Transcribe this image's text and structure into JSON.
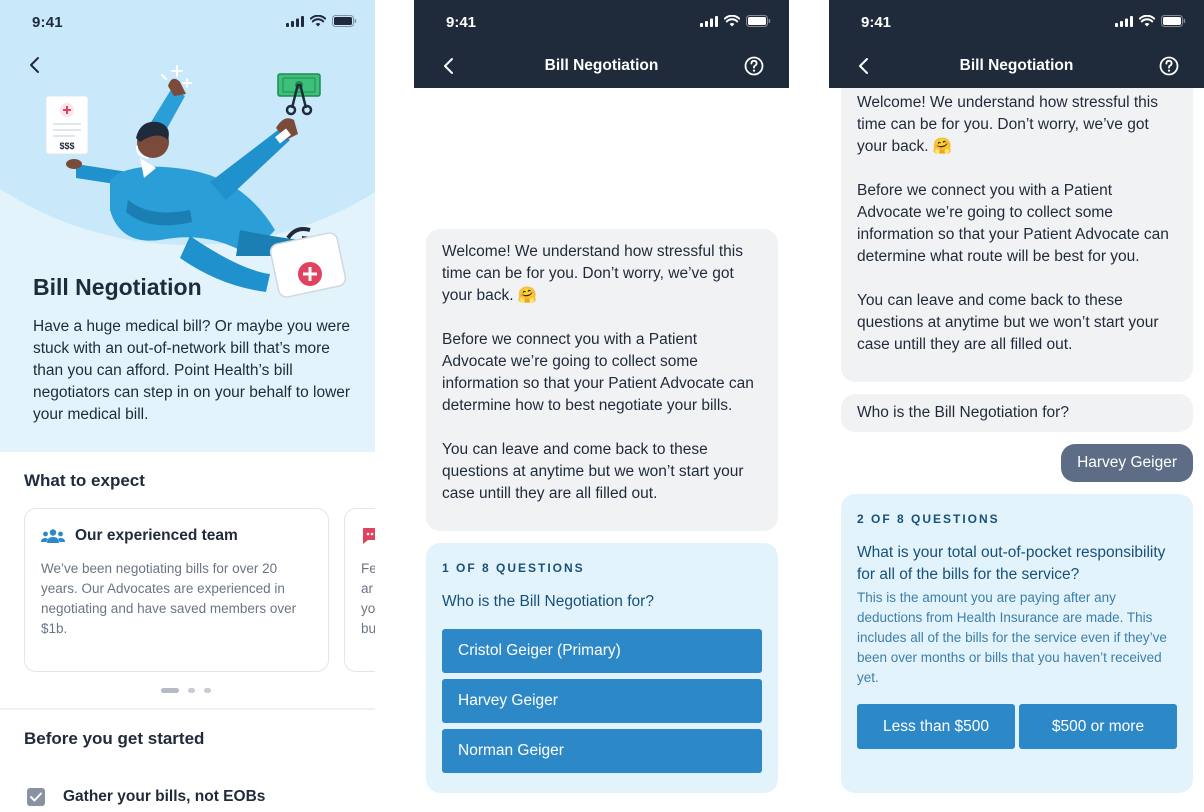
{
  "status_time": "9:41",
  "screen1": {
    "illustration_bill_text": "$$$",
    "title": "Bill Negotiation",
    "body": "Have a huge medical bill? Or maybe you were stuck with an out-of-network bill that’s more than you can afford. Point Health’s bill negotiators can step in on your behalf to lower your medical bill.",
    "expect_title": "What to expect",
    "cards": [
      {
        "title": "Our experienced team",
        "body": "We’ve been negotiating bills for over 20 years. Our Advocates are experienced in negotiating and have saved members over $1b."
      },
      {
        "body_partial": "Fe\nar\nyo\nbu"
      }
    ],
    "pager": {
      "count": 3,
      "active": 0
    },
    "start_title": "Before you get started",
    "checklist": [
      {
        "label": "Gather your bills, not EOBs",
        "checked": true
      }
    ]
  },
  "screen2": {
    "nav_title": "Bill Negotiation",
    "welcome": [
      "Welcome! We understand how stressful this time can be for you. Don’t worry, we’ve got your back. 🤗",
      "Before we connect you with a Patient Advocate we’re going to collect some information so that your Patient Advocate can determine how to best negotiate your bills.",
      "You can leave and come back to these questions at anytime but we won’t start your case untill they are all filled out."
    ],
    "question_count": "1 OF 8 QUESTIONS",
    "question": "Who is the Bill Negotiation for?",
    "options": [
      "Cristol Geiger (Primary)",
      "Harvey Geiger",
      "Norman Geiger"
    ]
  },
  "screen3": {
    "nav_title": "Bill Negotiation",
    "welcome": [
      "Welcome! We understand how stressful this time can be for you. Don’t worry, we’ve got your back. 🤗",
      "Before we connect you with a Patient Advocate we’re going to collect some information so that your Patient Advocate can determine what route will be best for you.",
      "You can leave and come back to these questions at anytime but we won’t start your case untill they are all filled out."
    ],
    "prev_question": "Who is the Bill Negotiation for?",
    "user_answer": "Harvey Geiger",
    "question_count": "2 OF 8 QUESTIONS",
    "question": "What is your total out-of-pocket responsibility for all of the bills for the service?",
    "question_help": "This is the amount you are paying after any deductions from Health Insurance are made. This includes all of the bills for the service even if they’ve been over months or bills that you haven’t received yet.",
    "options": [
      "Less than $500",
      "$500 or more"
    ]
  },
  "colors": {
    "navy": "#1f2a3a",
    "accent_blue": "#2d88c8",
    "panel_blue": "#e3f3fc",
    "question_text": "#16517a",
    "user_bubble": "#5c6d85"
  }
}
